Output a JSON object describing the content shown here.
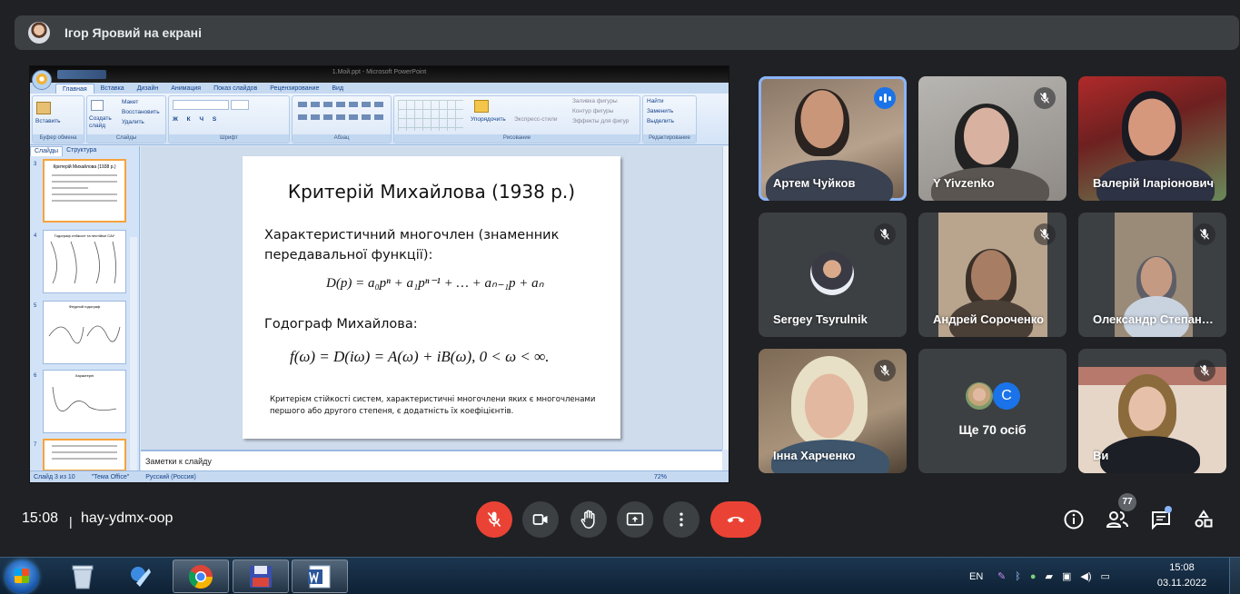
{
  "presenter_banner": {
    "text": "Ігор Яровий на екрані"
  },
  "shared_screen": {
    "window_title": "1.Мoй.ppt - Microsoft PowerPoint",
    "ribbon_tabs": [
      "Главная",
      "Вставка",
      "Дизайн",
      "Анимация",
      "Показ слайдов",
      "Рецензирование",
      "Вид"
    ],
    "ribbon_items": {
      "paste": "Вставить",
      "layout": "Макет",
      "reset": "Восстановить",
      "new_slide": "Создать слайд",
      "delete": "Удалить",
      "arrange": "Упорядочить",
      "quick_styles": "Экспресс-стили",
      "shape_fill": "Заливка фигуры",
      "shape_outline": "Контур фигуры",
      "shape_effects": "Эффекты для фигур",
      "find": "Найти",
      "replace": "Заменить",
      "select": "Выделить"
    },
    "ribbon_groups": [
      "Буфер обмена",
      "Слайды",
      "Шрифт",
      "Абзац",
      "Рисование",
      "Редактирование"
    ],
    "panel_tabs": [
      "Слайды",
      "Структура"
    ],
    "thumb_numbers": [
      "3",
      "4",
      "5",
      "6",
      "7"
    ],
    "thumb_titles": [
      "Критерій Михайлова (1938 р.)",
      "Годограф стійкості та нестійкої САУ",
      "Фігурний годограф",
      "Характерні"
    ],
    "slide": {
      "title": "Критерій Михайлова (1938 р.)",
      "paragraph1": "Характеристичний многочлен (знаменник передавальної функції):",
      "formula1": "D(p) = a₀pⁿ + a₁pⁿ⁻¹ + … + aₙ₋₁p + aₙ",
      "paragraph2": "Годограф Михайлова:",
      "formula2": "f(ω) = D(iω) = A(ω) + iB(ω),    0 < ω < ∞.",
      "paragraph3": "Критерієм стійкості систем, характеристичні многочлени яких є многочленами першого або другого степеня, є додатність їх коефіцієнтів."
    },
    "notes_placeholder": "Заметки к слайду",
    "status": {
      "slide": "Слайд 3 из 10",
      "theme": "\"Тема Office\"",
      "language": "Русский (Россия)",
      "zoom": "72%"
    }
  },
  "participants": [
    {
      "name": "Артем Чуйков",
      "speaking": true
    },
    {
      "name": "Y Yivzenko",
      "muted": true
    },
    {
      "name": "Валерій Іларіонович",
      "muted": false
    },
    {
      "name": "Sergey Tsyrulnik",
      "muted": true
    },
    {
      "name": "Андрей Сороченко",
      "muted": true
    },
    {
      "name": "Олександр Степанович",
      "muted": true
    },
    {
      "name": "Інна Харченко",
      "muted": true
    },
    {
      "name": "Ще 70 осіб",
      "avatar_letter": "C"
    },
    {
      "name": "Ви",
      "muted": true
    }
  ],
  "meeting": {
    "time": "15:08",
    "separator": "|",
    "code": "hay-ydmx-oop",
    "people_count": "77"
  },
  "controls": [
    "mic-off-icon",
    "camera-icon",
    "hand-icon",
    "present-icon",
    "more-icon",
    "end-call-icon"
  ],
  "taskbar": {
    "lang": "EN",
    "clock_time": "15:08",
    "clock_date": "03.11.2022"
  },
  "colors": {
    "meet_bg": "#202124",
    "tile_bg": "#3c4043",
    "accent_red": "#ea4335",
    "speaking_blue": "#1a73e8",
    "active_outline": "#8ab4f8"
  }
}
